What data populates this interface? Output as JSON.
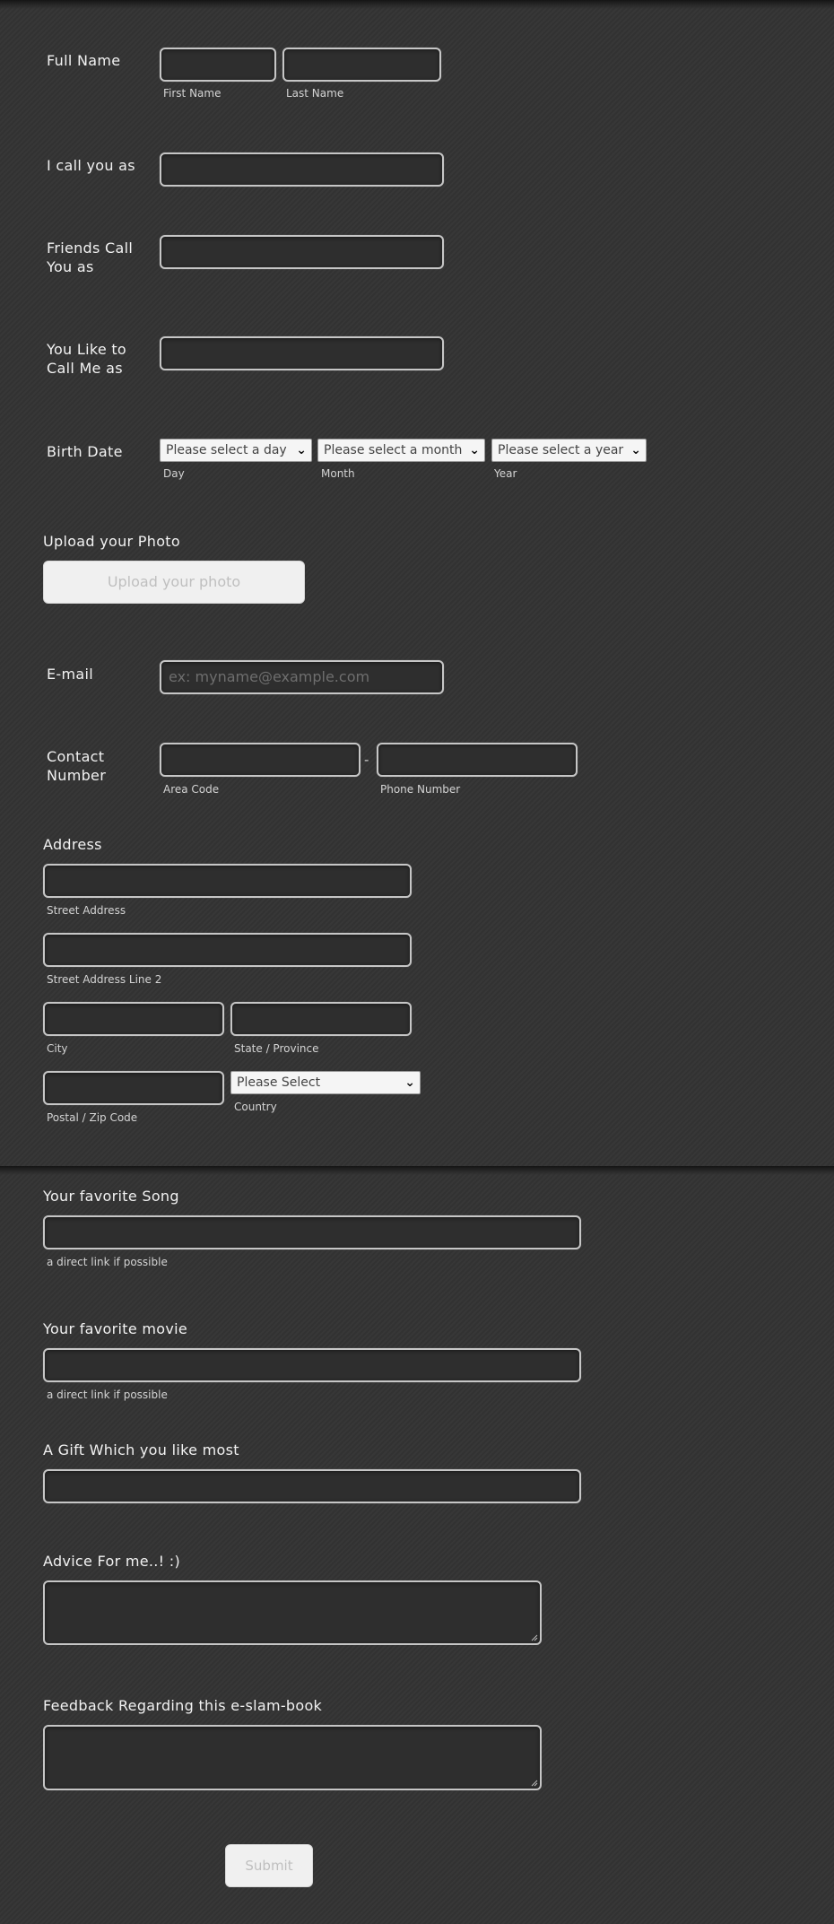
{
  "full_name": {
    "label": "Full Name",
    "first_sub": "First Name",
    "last_sub": "Last Name"
  },
  "call_you_as": {
    "label": "I call you as"
  },
  "friends_call": {
    "label_line1": "Friends Call",
    "label_line2": "You as"
  },
  "like_to_call": {
    "label_line1": "You Like to",
    "label_line2": "Call Me as"
  },
  "birth_date": {
    "label": "Birth Date",
    "day": {
      "value": "Please select a day",
      "sub": "Day"
    },
    "month": {
      "value": "Please select a month",
      "sub": "Month"
    },
    "year": {
      "value": "Please select a year",
      "sub": "Year"
    }
  },
  "photo": {
    "label": "Upload your Photo",
    "button": "Upload your photo"
  },
  "email": {
    "label": "E-mail",
    "placeholder": "ex: myname@example.com"
  },
  "contact": {
    "label_line1": "Contact",
    "label_line2": "Number",
    "dash": "-",
    "area_sub": "Area Code",
    "phone_sub": "Phone Number"
  },
  "address": {
    "label": "Address",
    "street_sub": "Street Address",
    "street2_sub": "Street Address Line 2",
    "city_sub": "City",
    "state_sub": "State / Province",
    "postal_sub": "Postal / Zip Code",
    "country": {
      "value": "Please Select",
      "sub": "Country"
    }
  },
  "song": {
    "label": "Your favorite Song",
    "sub": "a direct link if possible"
  },
  "movie": {
    "label": "Your favorite movie",
    "sub": "a direct link if possible"
  },
  "gift": {
    "label": "A Gift Which you like most"
  },
  "advice": {
    "label": "Advice For me..! :)"
  },
  "feedback": {
    "label": "Feedback Regarding this e-slam-book"
  },
  "submit": {
    "label": "Submit"
  },
  "icons": {
    "select_arrow": "chevron-down-icon",
    "textarea_grip": "resize-grip-icon"
  }
}
